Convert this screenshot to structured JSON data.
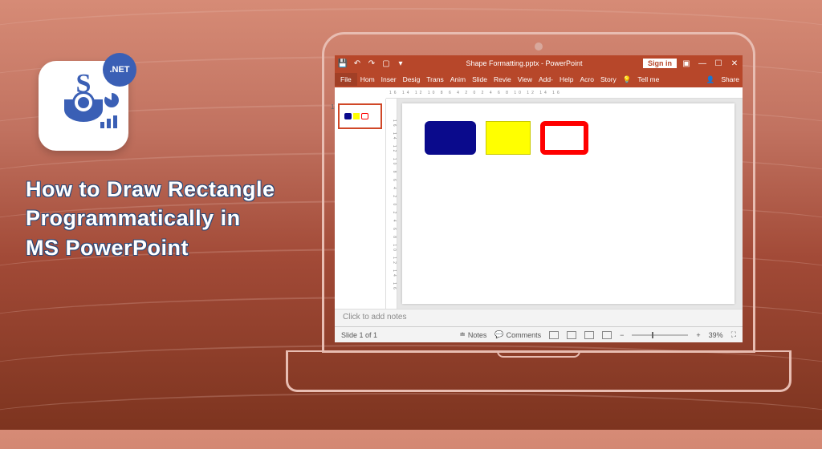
{
  "headline": {
    "line1": "How to Draw Rectangle",
    "line2": "Programmatically in",
    "line3": "MS PowerPoint"
  },
  "logo": {
    "letter": "S",
    "badge": ".NET"
  },
  "titlebar": {
    "doc_title": "Shape Formatting.pptx  -  PowerPoint",
    "sign_in": "Sign in"
  },
  "ribbon": {
    "file": "File",
    "tabs": [
      "Hom",
      "Inser",
      "Desig",
      "Trans",
      "Anim",
      "Slide",
      "Revie",
      "View",
      "Add-",
      "Help",
      "Acro",
      "Story"
    ],
    "tell_me": "Tell me",
    "share": "Share"
  },
  "thumbs": {
    "slide_num": "1"
  },
  "notes": {
    "placeholder": "Click to add notes"
  },
  "status": {
    "slide_info": "Slide 1 of 1",
    "notes_btn": "Notes",
    "comments_btn": "Comments",
    "zoom_minus": "−",
    "zoom_plus": "+",
    "zoom_value": "39%"
  },
  "shapes": [
    {
      "name": "blue-rounded-rect",
      "fill": "#0a0a8c"
    },
    {
      "name": "yellow-rect",
      "fill": "#ffff00"
    },
    {
      "name": "red-outline-rounded-rect",
      "stroke": "#ff0000"
    }
  ],
  "ruler_marks": "16 14 12 10 8 6 4 2 0 2 4 6 8 10 12 14 16"
}
